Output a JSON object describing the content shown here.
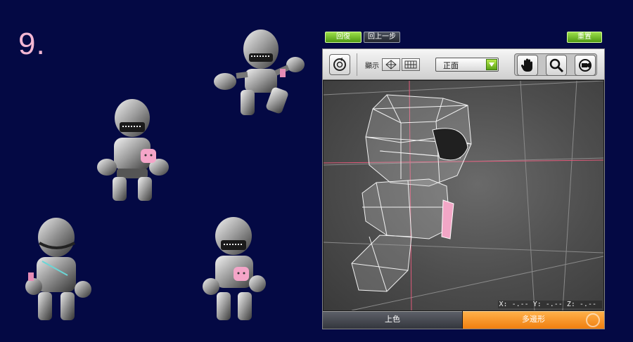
{
  "slide": {
    "number_label": "9."
  },
  "top_bar": {
    "restore_label": "回復",
    "undo_label": "回上一步",
    "reset_label": "重置"
  },
  "toolbar": {
    "rotate_icon": "rotate-reset-icon",
    "display_label": "顯示",
    "display_modes": [
      "wireframe-sphere-icon",
      "grid-icon"
    ],
    "view_select": {
      "value": "正面"
    },
    "tools": [
      "hand-pan-icon",
      "zoom-magnifier-icon",
      "camera-icon"
    ]
  },
  "viewport": {
    "coords": {
      "x": "X: -.--",
      "y": "Y: -.--",
      "z": "Z: -.--"
    }
  },
  "bottom_tabs": [
    {
      "label": "上色",
      "active": false
    },
    {
      "label": "多邊形",
      "active": true
    }
  ],
  "colors": {
    "background": "#040944",
    "accent_green": "#6dbb22",
    "accent_orange": "#f3901e",
    "slide_number": "#f3b7d3"
  }
}
